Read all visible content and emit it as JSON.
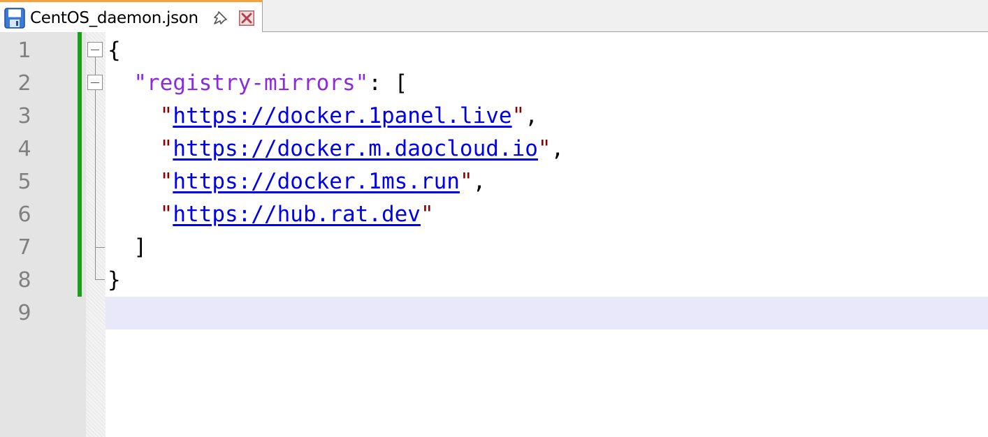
{
  "tab": {
    "title": "CentOS_daemon.json",
    "icons": [
      "save-icon",
      "pin-icon",
      "close-icon"
    ],
    "active_border_color": "#f6a23c"
  },
  "editor": {
    "line_numbers": [
      "1",
      "2",
      "3",
      "4",
      "5",
      "6",
      "7",
      "8",
      "9"
    ],
    "current_line": 9,
    "colors": {
      "key": "#8a2be2",
      "url": "#0000ee",
      "quote": "#8b0000",
      "change_bar": "#19a019",
      "current_line_bg": "#e8e8fa"
    },
    "lines": {
      "l1": {
        "open_brace": "{"
      },
      "l2": {
        "indent": "  ",
        "key": "\"registry-mirrors\"",
        "sep": ": ["
      },
      "l3": {
        "indent": "    ",
        "q1": "\"",
        "url": "https://docker.1panel.live",
        "q2": "\"",
        "tail": ","
      },
      "l4": {
        "indent": "    ",
        "q1": "\"",
        "url": "https://docker.m.daocloud.io",
        "q2": "\"",
        "tail": ","
      },
      "l5": {
        "indent": "    ",
        "q1": "\"",
        "url": "https://docker.1ms.run",
        "q2": "\"",
        "tail": ","
      },
      "l6": {
        "indent": "    ",
        "q1": "\"",
        "url": "https://hub.rat.dev",
        "q2": "\"",
        "tail": ""
      },
      "l7": {
        "indent": "  ",
        "close_bracket": "]"
      },
      "l8": {
        "close_brace": "}"
      },
      "l9": {}
    }
  }
}
